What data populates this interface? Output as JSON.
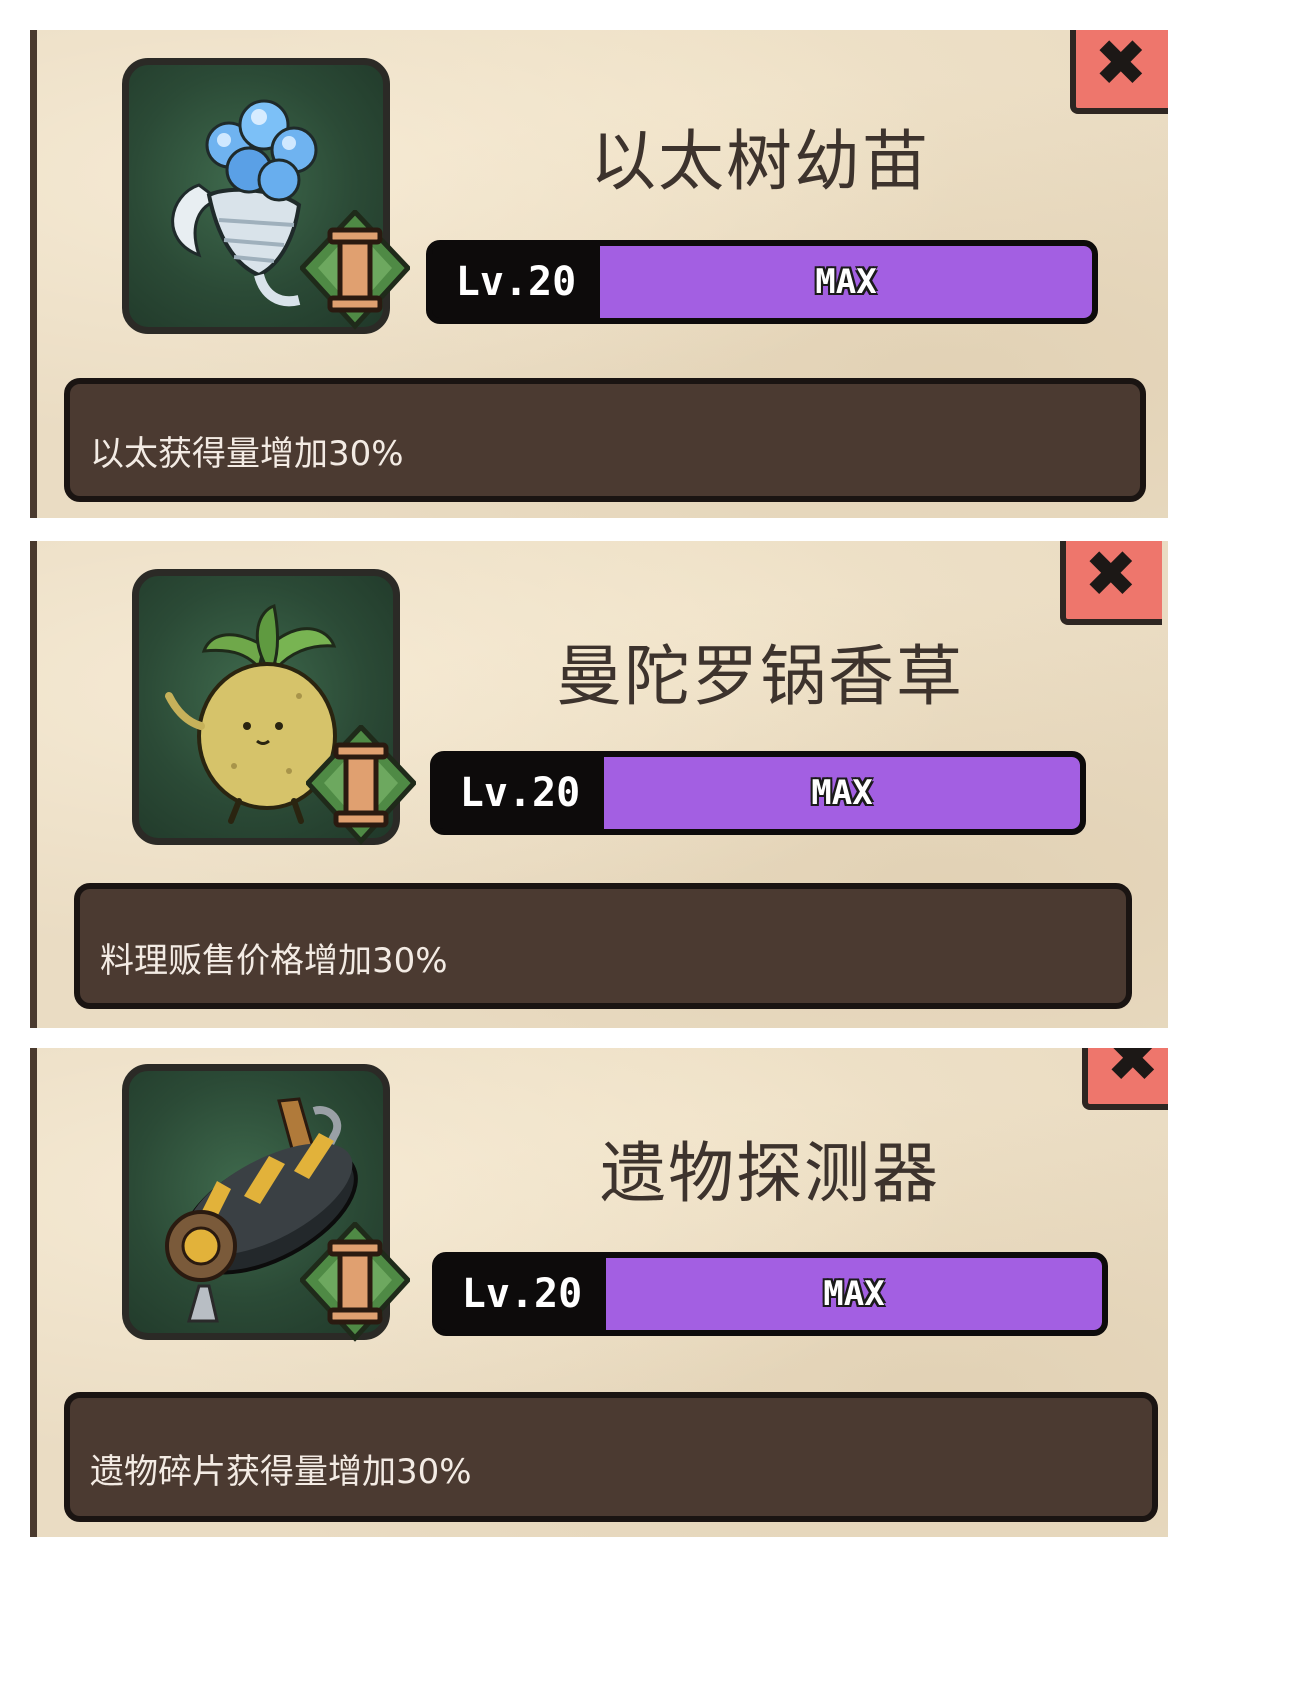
{
  "items": [
    {
      "icon": "ether-tree-sapling-icon",
      "title": "以太树幼苗",
      "tier": "I",
      "level": "Lv.20",
      "status": "MAX",
      "progress": 1.0,
      "description": "以太获得量增加30%"
    },
    {
      "icon": "mandrake-herb-icon",
      "title": "曼陀罗锅香草",
      "tier": "I",
      "level": "Lv.20",
      "status": "MAX",
      "progress": 1.0,
      "description": "料理贩售价格增加30%"
    },
    {
      "icon": "relic-detector-icon",
      "title": "遗物探测器",
      "tier": "I",
      "level": "Lv.20",
      "status": "MAX",
      "progress": 1.0,
      "description": "遗物碎片获得量增加30%"
    }
  ],
  "close_glyph": "✖",
  "colors": {
    "panel_bg": "#eadcc3",
    "progress_fill": "#a35fe2",
    "close_button": "#ee766c",
    "description_bg": "#4b3a31",
    "title_text": "#3d332d"
  }
}
